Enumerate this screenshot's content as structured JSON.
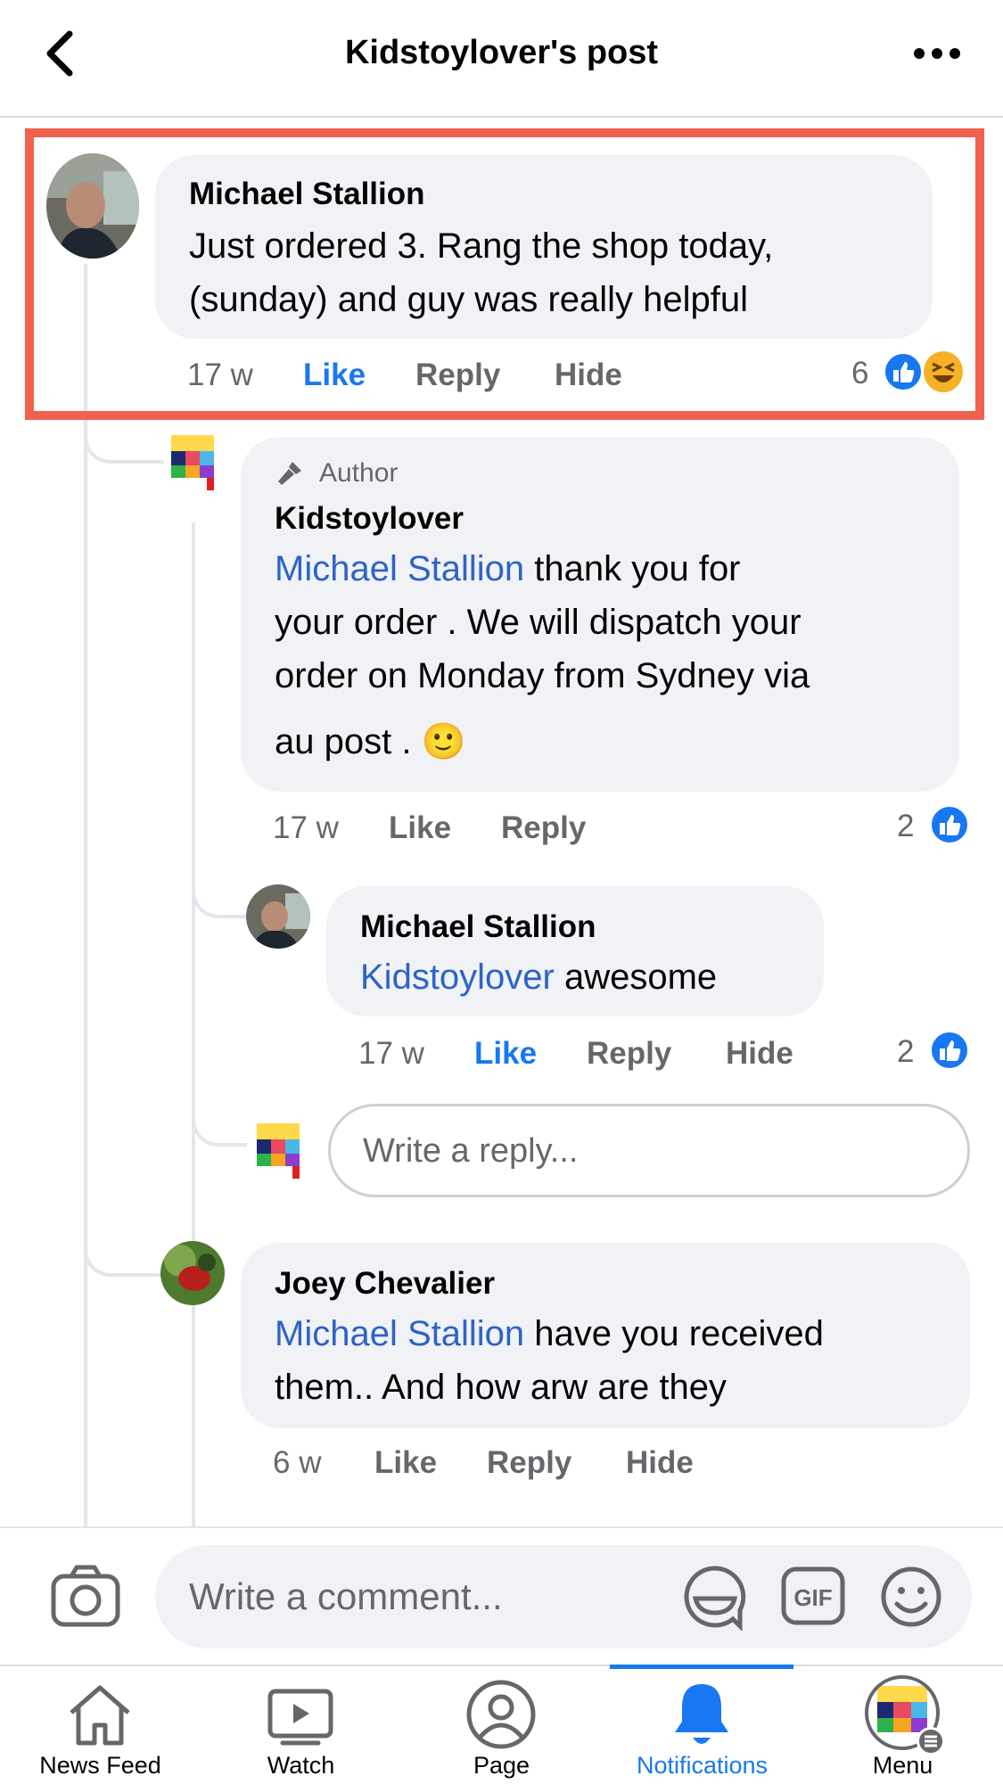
{
  "header": {
    "title": "Kidstoylover's post"
  },
  "comments": [
    {
      "author": "Michael Stallion",
      "text": "Just ordered 3. Rang the shop today, (sunday) and guy was really helpful",
      "line1": "Just ordered 3. Rang the shop today,",
      "line2": "(sunday) and guy was really helpful",
      "time": "17 w",
      "like": "Like",
      "reply": "Reply",
      "hide": "Hide",
      "reactions": "6",
      "liked": true
    },
    {
      "badge": "Author",
      "author": "Kidstoylover",
      "mention": "Michael Stallion",
      "line1_rest": " thank you for",
      "line2": "your order . We will dispatch your",
      "line3": "order on Monday from Sydney via",
      "line4": "au post . ",
      "emoji": "🙂",
      "time": "17 w",
      "like": "Like",
      "reply": "Reply",
      "reactions": "2"
    },
    {
      "author": "Michael Stallion",
      "mention": "Kidstoylover",
      "text_rest": " awesome",
      "time": "17 w",
      "like": "Like",
      "reply": "Reply",
      "hide": "Hide",
      "reactions": "2",
      "liked": true
    },
    {
      "author": "Joey Chevalier",
      "mention": "Michael Stallion",
      "line1_rest": " have you received",
      "line2": "them.. And how arw are they",
      "time": "6 w",
      "like": "Like",
      "reply": "Reply",
      "hide": "Hide"
    }
  ],
  "reply_input": {
    "placeholder": "Write a reply..."
  },
  "composer": {
    "placeholder": "Write a comment..."
  },
  "avatar_logo_text": "Kidstoylover",
  "tabs": [
    {
      "label": "News Feed",
      "icon": "home-icon"
    },
    {
      "label": "Watch",
      "icon": "watch-icon"
    },
    {
      "label": "Page",
      "icon": "page-icon"
    },
    {
      "label": "Notifications",
      "icon": "bell-icon",
      "active": true
    },
    {
      "label": "Menu",
      "icon": "menu-avatar-icon"
    }
  ],
  "colors": {
    "accent": "#1877f2",
    "mention": "#2d63c8",
    "highlight": "#f0614f",
    "bubble": "#f0f2f5"
  }
}
